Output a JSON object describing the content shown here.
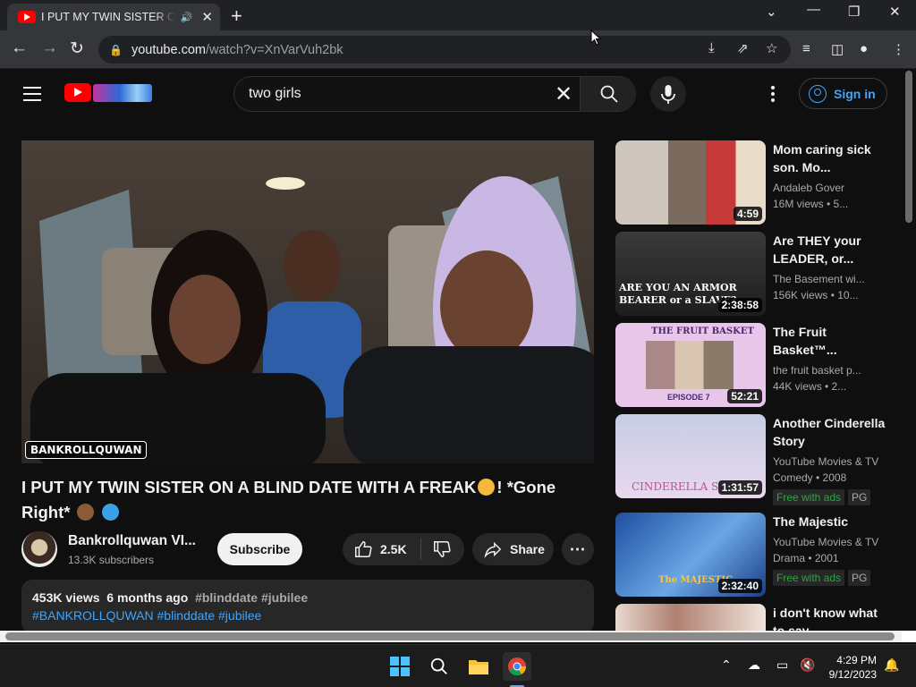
{
  "browser": {
    "tab_title": "I PUT MY TWIN SISTER ON A BLIND DATE WITH A FREAK",
    "url_host": "youtube.com",
    "url_path": "/watch?v=XnVarVuh2bk"
  },
  "header": {
    "search_value": "two girls",
    "signin_label": "Sign in"
  },
  "player": {
    "watermark": "BANKROLLQUWAN"
  },
  "video": {
    "title": "I PUT MY TWIN SISTER ON A BLIND DATE WITH A FREAK",
    "title_suffix_a": "! *Gone",
    "title_line2": "Right*",
    "channel_name": "Bankrollquwan VI...",
    "subscribers": "13.3K subscribers",
    "subscribe_label": "Subscribe",
    "likes": "2.5K",
    "share_label": "Share",
    "views": "453K views",
    "age": "6 months ago",
    "desc_tags": "#blinddate #jubilee",
    "desc_line2": "#BANKROLLQUWAN #blinddate #jubilee"
  },
  "recommendations": [
    {
      "title": "Mom caring sick son. Mo...",
      "channel": "Andaleb Gover",
      "stats": "16M views  •  5...",
      "duration": "4:59"
    },
    {
      "title": "Are THEY your LEADER, or...",
      "channel": "The Basement wi...",
      "stats": "156K views  •  10...",
      "duration": "2:38:58",
      "thumb_text": "ARE YOU AN ARMOR BEARER or a SLAVE?"
    },
    {
      "title": "The Fruit Basket™...",
      "channel": "the fruit basket p...",
      "stats": "44K views  •  2...",
      "duration": "52:21",
      "thumb_text": "THE FRUIT BASKET",
      "thumb_sub": "EPISODE 7"
    },
    {
      "title": "Another Cinderella Story",
      "channel": "YouTube Movies & TV",
      "stats": "Comedy • 2008",
      "duration": "1:31:57",
      "badge": "Free with ads",
      "rating": "PG",
      "thumb_text": "CINDERELLA S"
    },
    {
      "title": "The Majestic",
      "channel": "YouTube Movies & TV",
      "stats": "Drama • 2001",
      "duration": "2:32:40",
      "badge": "Free with ads",
      "rating": "PG",
      "thumb_text": "The MAJESTIC"
    },
    {
      "title": "i don't know what to say",
      "channel": "",
      "stats": "",
      "duration": ""
    }
  ],
  "taskbar": {
    "time": "4:29 PM",
    "date": "9/12/2023"
  },
  "icons": [
    "youtube-icon",
    "speaker-icon",
    "close-icon",
    "plus-icon",
    "chevron-down-icon",
    "minimize-icon",
    "restore-icon",
    "back-icon",
    "forward-icon",
    "reload-icon",
    "lock-icon",
    "download-icon",
    "share-icon",
    "star-icon",
    "media-icon",
    "sidepanel-icon",
    "profile-icon",
    "menu-icon",
    "search-icon",
    "mic-icon",
    "like-icon",
    "dislike-icon",
    "more-icon",
    "windows-icon",
    "folder-icon",
    "chrome-icon",
    "bell-icon"
  ]
}
